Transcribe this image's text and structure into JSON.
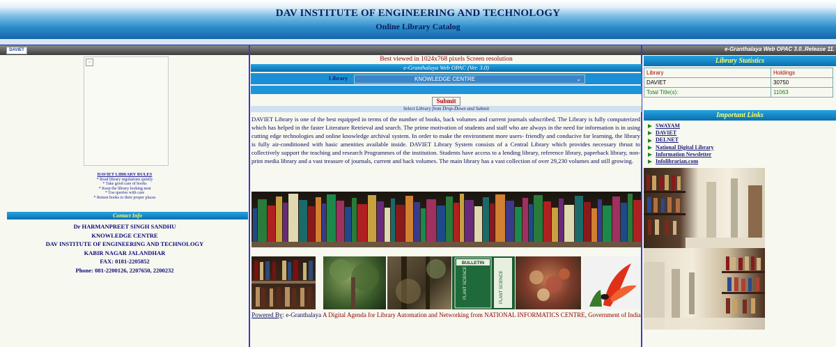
{
  "header": {
    "title": "DAV INSTITUTE OF ENGINEERING AND TECHNOLOGY",
    "subtitle": "Online Library Catalog"
  },
  "topbar": {
    "logo_text": "DAVIET",
    "release_text": "e-Granthalaya Web OPAC 3.0..Release 11."
  },
  "left": {
    "rules_title": "DAVIET LIBRARY RULES",
    "rules": [
      "* Read library regulations quietly",
      "* Take good care of books",
      "* Keep the library looking neat",
      "* Use queries with care",
      "* Return books to their proper places"
    ],
    "contact_header": "Contact Info",
    "contact_lines": [
      "Dr HARMANPREET SINGH SANDHU",
      "KNOWLEDGE CENTRE",
      "DAV INSTITUTE OF ENGINEERING AND TECHNOLOGY",
      "KABIR NAGAR JALANDHAR",
      "FAX: 0181-2205852",
      "Phone: 081-2200126, 2207650, 2200232"
    ]
  },
  "main": {
    "best_viewed": "Best viewed in 1024x768 pixels Screen resolution",
    "opac_title": "e-Granthalaya Web OPAC (Ver. 3.0)",
    "library_label": "Library",
    "library_selected": "KNOWLEDGE CENTRE",
    "submit_label": "Submit",
    "select_hint": "Select Library from Drop-Down and Submit",
    "description": "DAVIET Library is one of the best equipped in terms of the number of books, back volumes and current journals subscribed. The Library is fully computerized which has helped in the faster Literature Retrieval and search. The prime motivation of students and staff who are always in the need for information is in using cutting edge technologies and online knowledge archival system. In order to make the environment more users- friendly and conducive for learning, the library is fully air-conditioned with basic amenities available inside. DAVIET Library System consists of a Central Library which provides necessary thrust to collectively support the teaching and research Programmes of the institution. Students have access to a lending library, reference library, paperback library, non-print media library and a vast treasure of journals, current and back volumes. The main library has a vast collection of over 29,230 volumes and still growing.",
    "bulletin_text": "BULLETIN",
    "plant_science_text": "PLANT SCIENCE",
    "powered_by_label": "Powered By",
    "powered_product": "e-Granthalaya",
    "powered_desc": "A Digital Agenda for Library Automation and Networking from NATIONAL INFORMATICS CENTRE, Government of India"
  },
  "stats": {
    "header": "Library Statistics",
    "col_library": "Library",
    "col_holdings": "Holdings",
    "rows": [
      {
        "library": "DAVIET",
        "holdings": "30750"
      }
    ],
    "total_label": "Total Title(s):",
    "total_value": "11063"
  },
  "links": {
    "header": "Important Links",
    "items": [
      "SWAYAM",
      "DAVIET",
      "DELNET",
      "National Digital Library",
      "Information Newsletter",
      "Infolibrarian.com"
    ]
  },
  "colors": {
    "accent_bar": "#0a6fb0",
    "header_title": "#0b1f5e",
    "link_arrow": "#1a8a1a",
    "stat_header_text": "#ffff66"
  }
}
